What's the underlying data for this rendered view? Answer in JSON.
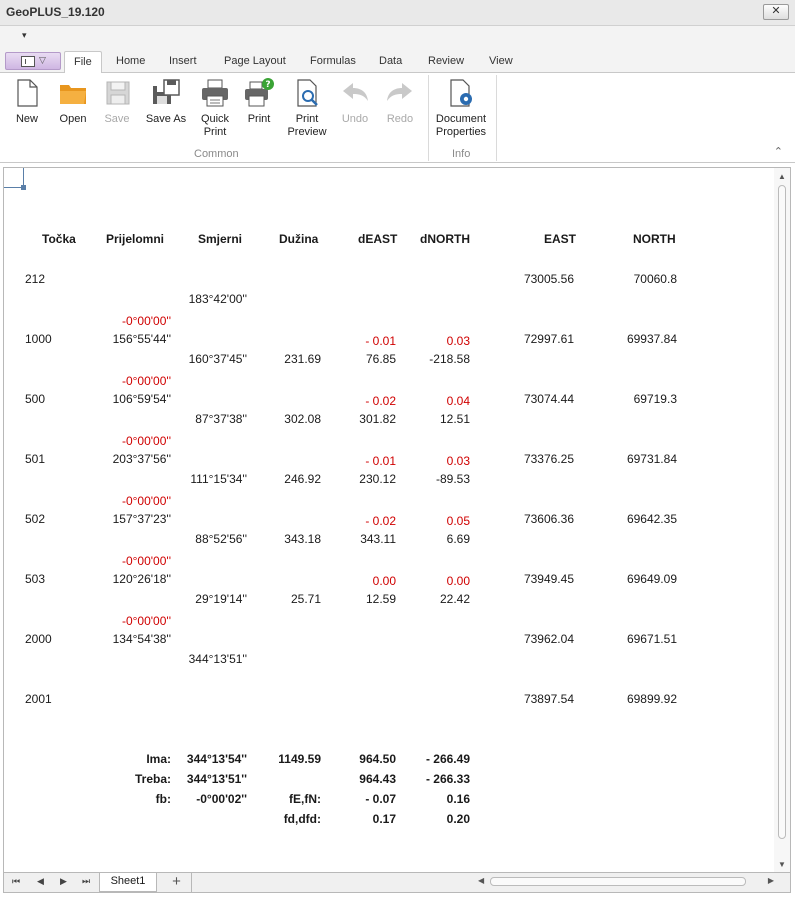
{
  "window": {
    "title": "GeoPLUS_19.120",
    "close_label": "✕"
  },
  "qat": {
    "dropdown": "▾"
  },
  "tabs": [
    {
      "label": "File"
    },
    {
      "label": "Home"
    },
    {
      "label": "Insert"
    },
    {
      "label": "Page Layout"
    },
    {
      "label": "Formulas"
    },
    {
      "label": "Data"
    },
    {
      "label": "Review"
    },
    {
      "label": "View"
    }
  ],
  "ribbon": {
    "buttons": [
      {
        "line1": "New",
        "line2": ""
      },
      {
        "line1": "Open",
        "line2": ""
      },
      {
        "line1": "Save",
        "line2": ""
      },
      {
        "line1": "Save As",
        "line2": ""
      },
      {
        "line1": "Quick",
        "line2": "Print"
      },
      {
        "line1": "Print",
        "line2": ""
      },
      {
        "line1": "Print",
        "line2": "Preview"
      },
      {
        "line1": "Undo",
        "line2": ""
      },
      {
        "line1": "Redo",
        "line2": ""
      },
      {
        "line1": "Document",
        "line2": "Properties"
      }
    ],
    "groups": {
      "common": "Common",
      "info": "Info"
    },
    "collapse": "⌃"
  },
  "table": {
    "headers": [
      "Točka",
      "Prijelomni",
      "Smjerni",
      "Dužina",
      "dEAST",
      "dNORTH",
      "EAST",
      "NORTH"
    ],
    "stations": [
      {
        "tocka": "212",
        "east": "73005.56",
        "north": "70060.8"
      },
      {
        "tocka": "1000",
        "corr": "-0°00'00''",
        "angle": "156°55'44''",
        "de_corr": "- 0.01",
        "dn_corr": "0.03",
        "east": "72997.61",
        "north": "69937.84"
      },
      {
        "tocka": "500",
        "corr": "-0°00'00''",
        "angle": "106°59'54''",
        "de_corr": "- 0.02",
        "dn_corr": "0.04",
        "east": "73074.44",
        "north": "69719.3"
      },
      {
        "tocka": "501",
        "corr": "-0°00'00''",
        "angle": "203°37'56''",
        "de_corr": "- 0.01",
        "dn_corr": "0.03",
        "east": "73376.25",
        "north": "69731.84"
      },
      {
        "tocka": "502",
        "corr": "-0°00'00''",
        "angle": "157°37'23''",
        "de_corr": "- 0.02",
        "dn_corr": "0.05",
        "east": "73606.36",
        "north": "69642.35"
      },
      {
        "tocka": "503",
        "corr": "-0°00'00''",
        "angle": "120°26'18''",
        "de_corr": "0.00",
        "dn_corr": "0.00",
        "east": "73949.45",
        "north": "69649.09"
      },
      {
        "tocka": "2000",
        "corr": "-0°00'00''",
        "angle": "134°54'38''",
        "east": "73962.04",
        "north": "69671.51"
      },
      {
        "tocka": "2001",
        "east": "73897.54",
        "north": "69899.92"
      }
    ],
    "legs": [
      {
        "smjerni": "183°42'00''"
      },
      {
        "smjerni": "160°37'45''",
        "duzina": "231.69",
        "deast": "76.85",
        "dnorth": "-218.58"
      },
      {
        "smjerni": "87°37'38''",
        "duzina": "302.08",
        "deast": "301.82",
        "dnorth": "12.51"
      },
      {
        "smjerni": "111°15'34''",
        "duzina": "246.92",
        "deast": "230.12",
        "dnorth": "-89.53"
      },
      {
        "smjerni": "88°52'56''",
        "duzina": "343.18",
        "deast": "343.11",
        "dnorth": "6.69"
      },
      {
        "smjerni": "29°19'14''",
        "duzina": "25.71",
        "deast": "12.59",
        "dnorth": "22.42"
      },
      {
        "smjerni": "344°13'51''"
      }
    ]
  },
  "summary": {
    "ima": {
      "label": "Ima:",
      "angle": "344°13'54''",
      "duzina": "1149.59",
      "deast": "964.50",
      "dnorth": "- 266.49"
    },
    "treba": {
      "label": "Treba:",
      "angle": "344°13'51''",
      "deast": "964.43",
      "dnorth": "- 266.33"
    },
    "fb": {
      "label": "fb:",
      "angle": "-0°00'02''",
      "mid_label": "fE,fN:",
      "deast": "- 0.07",
      "dnorth": "0.16"
    },
    "fd": {
      "mid_label": "fd,dfd:",
      "deast": "0.17",
      "dnorth": "0.20"
    }
  },
  "sheetbar": {
    "sheet_name": "Sheet1",
    "add_label": "+"
  },
  "colors": {
    "accent": "#d00000",
    "app_button": "#cfb6e3",
    "folder": "#f5a623"
  }
}
